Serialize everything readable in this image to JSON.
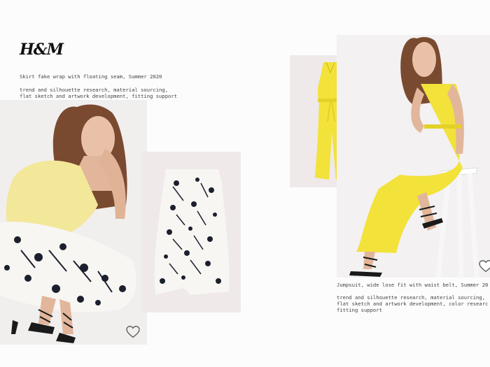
{
  "brand": {
    "logo_text": "H&M"
  },
  "look1": {
    "title": "Skirt fake wrap with floating seam, Summer 2020",
    "description": "trend and silhouette research, material sourcing,\nflat sketch and artwork development, fitting support"
  },
  "look2": {
    "title": "Jumpsuit, wide lose fit with waist belt, Summer 20",
    "description": "trend and silhouette research, material sourcing,\nflat sketch and artwork development, color researc\nfitting support"
  },
  "colors": {
    "background": "#fdfcfd",
    "photo_bg": "#efe9ea",
    "yellow": "#f2e23a",
    "pale_yellow": "#f3e79a",
    "print_dark": "#1c1f2e",
    "print_light": "#f7f6f2"
  },
  "icons": [
    "favorite-heart-icon",
    "favorite-heart-icon"
  ]
}
